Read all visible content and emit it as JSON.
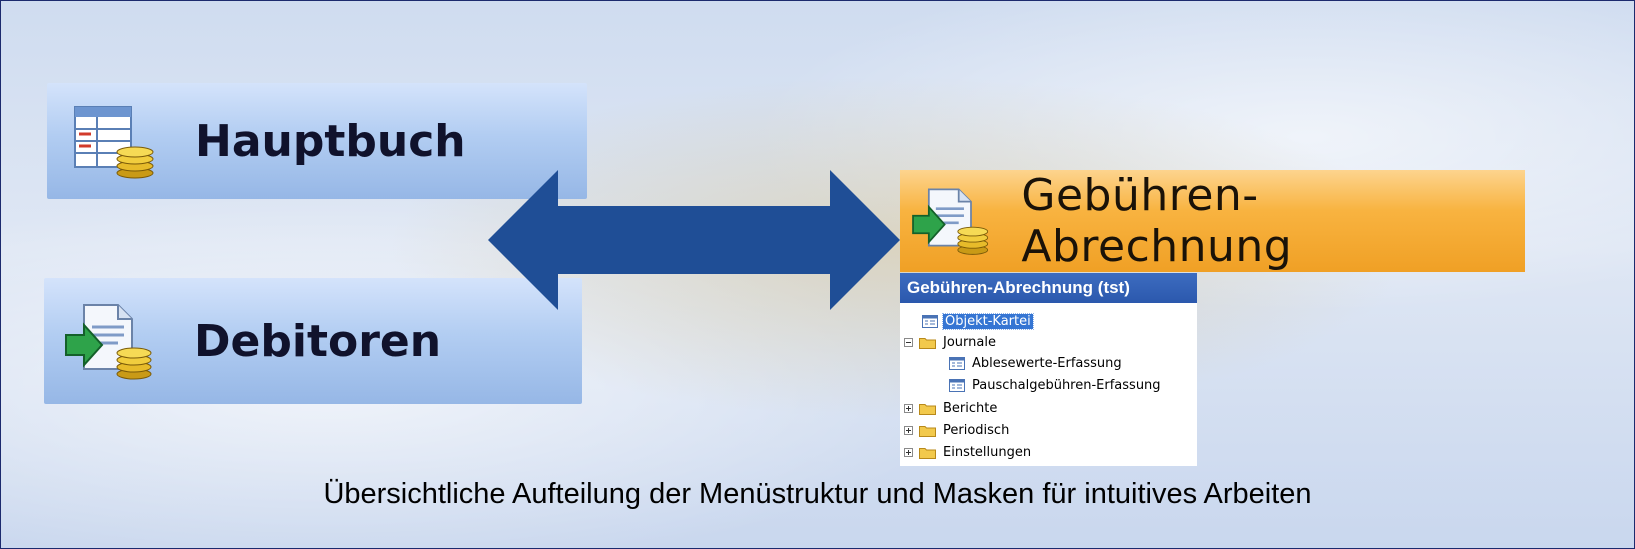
{
  "menu_buttons": {
    "hauptbuch": {
      "label": "Hauptbuch",
      "icon": "ledger-coins-icon"
    },
    "debitoren": {
      "label": "Debitoren",
      "icon": "document-arrow-coins-icon"
    },
    "gebuehren": {
      "label": "Gebühren-Abrechnung",
      "icon": "document-arrow-coins-icon"
    }
  },
  "nav_pane": {
    "title": "Gebühren-Abrechnung (tst)",
    "items": [
      {
        "label": "Objekt-Kartei",
        "icon": "form-icon",
        "selected": true
      },
      {
        "label": "Journale",
        "icon": "folder-icon",
        "expander": "collapse"
      },
      {
        "label": "Ablesewerte-Erfassung",
        "icon": "form-icon"
      },
      {
        "label": "Pauschalgebühren-Erfassung",
        "icon": "form-icon"
      },
      {
        "label": "Berichte",
        "icon": "folder-icon",
        "expander": "expand"
      },
      {
        "label": "Periodisch",
        "icon": "folder-icon",
        "expander": "expand"
      },
      {
        "label": "Einstellungen",
        "icon": "folder-icon",
        "expander": "expand"
      }
    ]
  },
  "arrow": {
    "icon": "double-arrow-icon",
    "color": "#1f4e96"
  },
  "caption": "Übersichtliche Aufteilung der Menüstruktur und Masken für intuitives Arbeiten",
  "colors": {
    "menu_blue": "#b2cdf2",
    "menu_orange": "#f8b340",
    "nav_title_blue": "#2b58ad",
    "selection": "#3575d3"
  }
}
